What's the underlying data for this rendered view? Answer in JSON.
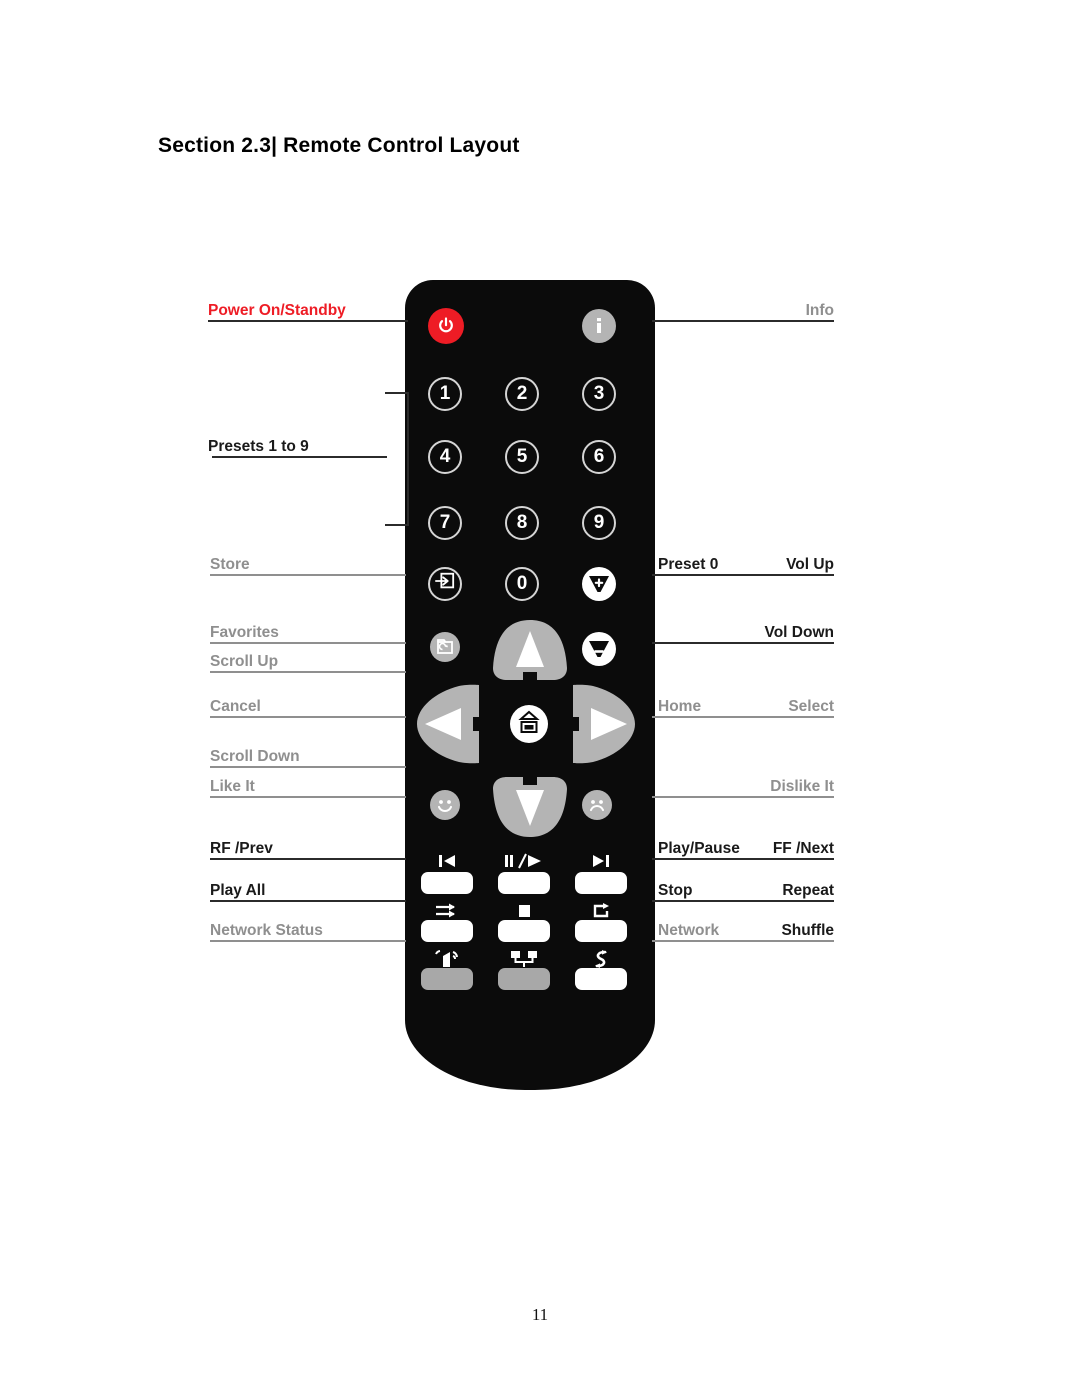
{
  "document": {
    "section_heading": "Section 2.3| Remote Control Layout",
    "page_number": "11"
  },
  "colors": {
    "power_red": "#ee1c25",
    "remote_body": "#0b0b0b",
    "key_gray": "#b4b4b4",
    "label_gray": "#8f8f8f",
    "label_dark": "#1a1a1a"
  },
  "callouts": {
    "left": [
      {
        "label": "Power On/Standby",
        "style": "red",
        "icon": "power-icon"
      },
      {
        "label": "Presets 1 to 9",
        "style": "dark",
        "icon": "number-keys-icon"
      },
      {
        "label": "Store",
        "style": "gray",
        "icon": "store-icon"
      },
      {
        "label": "Favorites",
        "style": "gray",
        "icon": "favorites-icon"
      },
      {
        "label": "Scroll Up",
        "style": "gray",
        "icon": "arrow-up-icon"
      },
      {
        "label": "Cancel",
        "style": "gray",
        "icon": "arrow-left-icon"
      },
      {
        "label": "Scroll Down",
        "style": "gray",
        "icon": "arrow-down-icon"
      },
      {
        "label": "Like It",
        "style": "gray",
        "icon": "smiley-icon"
      },
      {
        "label": "RF /Prev",
        "style": "dark",
        "icon": "previous-track-icon"
      },
      {
        "label": "Play All",
        "style": "dark",
        "icon": "play-all-icon"
      },
      {
        "label": "Network Status",
        "style": "gray",
        "icon": "network-status-icon"
      }
    ],
    "right": [
      {
        "label": "Info",
        "style": "gray",
        "icon": "info-icon"
      },
      {
        "label": "Preset 0",
        "style": "dark",
        "icon": "zero-key-icon"
      },
      {
        "label": "Vol Up",
        "style": "dark",
        "icon": "volume-up-icon"
      },
      {
        "label": "Vol Down",
        "style": "dark",
        "icon": "volume-down-icon"
      },
      {
        "label": "Home",
        "style": "gray",
        "icon": "home-icon"
      },
      {
        "label": "Select",
        "style": "gray",
        "icon": "arrow-right-icon"
      },
      {
        "label": "Dislike It",
        "style": "gray",
        "icon": "frowny-icon"
      },
      {
        "label": "Play/Pause",
        "style": "dark",
        "icon": "play-pause-icon"
      },
      {
        "label": "FF /Next",
        "style": "dark",
        "icon": "next-track-icon"
      },
      {
        "label": "Stop",
        "style": "dark",
        "icon": "stop-icon"
      },
      {
        "label": "Repeat",
        "style": "dark",
        "icon": "repeat-icon"
      },
      {
        "label": "Network",
        "style": "gray",
        "icon": "network-icon"
      },
      {
        "label": "Shuffle",
        "style": "dark",
        "icon": "shuffle-icon"
      }
    ]
  },
  "remote": {
    "keypad": [
      "1",
      "2",
      "3",
      "4",
      "5",
      "6",
      "7",
      "8",
      "9"
    ],
    "zero_key": "0"
  }
}
